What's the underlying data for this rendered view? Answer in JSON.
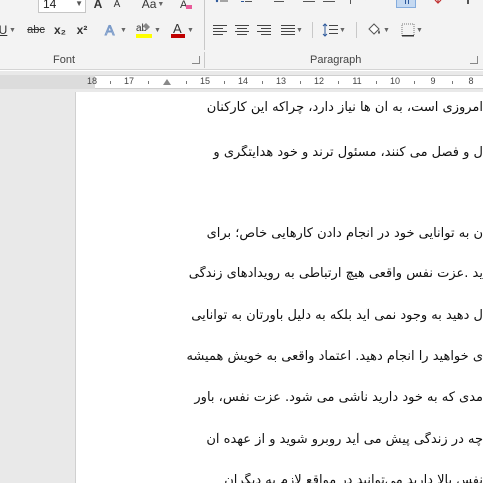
{
  "ribbon": {
    "font_size": "14",
    "buttons": {
      "grow_font": "A",
      "shrink_font": "A",
      "change_case": "Aa",
      "underline": "U",
      "strikethrough": "abc",
      "subscript": "x₂",
      "superscript": "x²",
      "text_effects": "A",
      "highlight": "ab",
      "font_color": "A"
    },
    "groups": {
      "font_label": "Font",
      "paragraph_label": "Paragraph"
    },
    "colors": {
      "highlight": "#ffff00",
      "font_color": "#c00000",
      "active_button": "#c5d9f1"
    }
  },
  "ruler": {
    "numbers": [
      "18",
      "17",
      "15",
      "14",
      "13",
      "12",
      "11",
      "10",
      "9",
      "8"
    ]
  },
  "document": {
    "lines": [
      "امروزی است، به آن ها نیاز دارد، چراکه این کارکنان",
      "ل و فصل می کنند، مسئول ترند و خود هدایتگری و",
      "",
      "ن به توانایی خود در انجام دادن کارهایی خاص؛ برای",
      "ید .عزت نفس واقعی هیچ ارتباطی به رویدادهای زندگی",
      "ل دهید به وجود نمی آید بلکه به دلیل باورتان به توانایی",
      "ی خواهید را انجام دهید. اعتماد واقعی به خویش همیشه",
      "مدی که به خود دارید ناشی می شود. عزت نفس، باور",
      "چه در زندگی پیش می آید روبرو شوید و از عهده آن",
      "نفس بالا دارید می‌توانید در مواقع لازم به دیگران"
    ]
  }
}
